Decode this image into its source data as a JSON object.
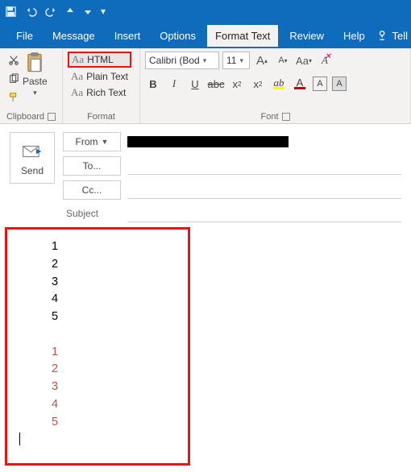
{
  "quick_access": [
    "save",
    "undo",
    "redo",
    "up",
    "down"
  ],
  "tabs": {
    "file": "File",
    "message": "Message",
    "insert": "Insert",
    "options": "Options",
    "format_text": "Format Text",
    "review": "Review",
    "help": "Help",
    "tell": "Tell"
  },
  "ribbon": {
    "clipboard": {
      "paste": "Paste",
      "label": "Clipboard"
    },
    "format": {
      "html": "HTML",
      "plain": "Plain Text",
      "rich": "Rich Text",
      "aa": "Aa",
      "label": "Format"
    },
    "font": {
      "name": "Calibri (Bod",
      "size": "11",
      "label": "Font",
      "grow": "A",
      "shrink": "A",
      "changecase": "Aa",
      "bold": "B",
      "italic": "I",
      "underline": "U",
      "strike": "abc",
      "sub": "x",
      "sup": "x",
      "hilite": "A",
      "color": "A",
      "boxA1": "A",
      "boxA2": "A"
    }
  },
  "compose": {
    "send": "Send",
    "from": "From",
    "to": "To...",
    "cc": "Cc...",
    "subject_label": "Subject",
    "from_value": "",
    "to_value": "",
    "cc_value": "",
    "subject_value": ""
  },
  "body": {
    "black": [
      "1",
      "2",
      "3",
      "4",
      "5"
    ],
    "red": [
      "1",
      "2",
      "3",
      "4",
      "5"
    ]
  },
  "colors": {
    "accent": "#0f6cbd",
    "highlight_border": "#e11",
    "font_red": "#c00000",
    "hilite": "#ffff00"
  }
}
